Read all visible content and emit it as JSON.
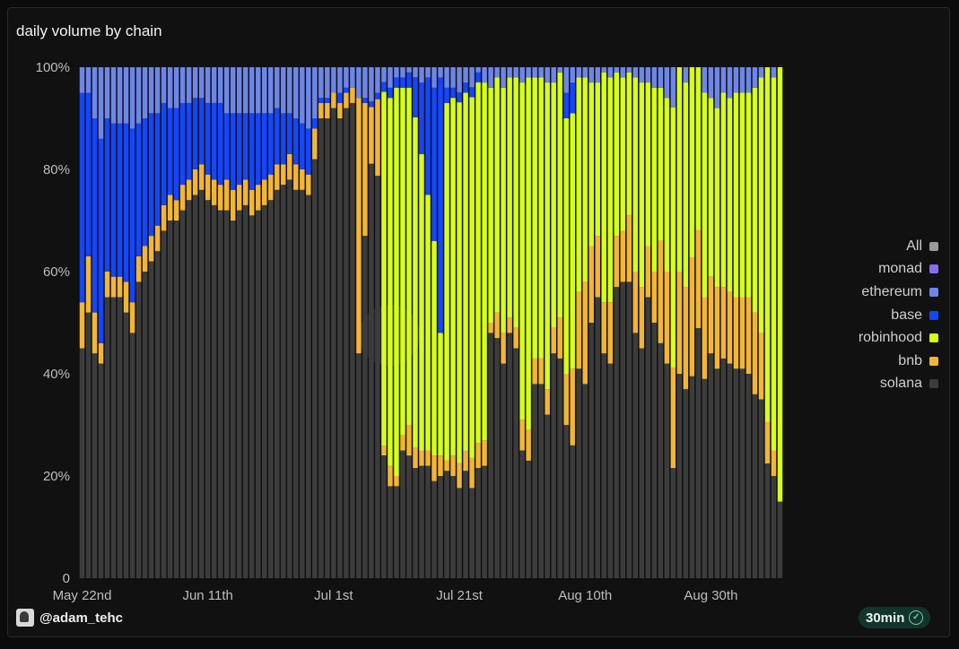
{
  "title": "daily volume by chain",
  "footer": {
    "user": "@adam_tehc",
    "refresh": "30min"
  },
  "legend": [
    {
      "label": "All",
      "color": "#9a9a9a"
    },
    {
      "label": "monad",
      "color": "#8a6cf0"
    },
    {
      "label": "ethereum",
      "color": "#6e86e8"
    },
    {
      "label": "base",
      "color": "#1446ff"
    },
    {
      "label": "robinhood",
      "color": "#d7ff1a"
    },
    {
      "label": "bnb",
      "color": "#f3b535"
    },
    {
      "label": "solana",
      "color": "#3c3c3c"
    }
  ],
  "chart_data": {
    "type": "bar",
    "stacked": true,
    "normalized": true,
    "xlabel": "",
    "ylabel": "",
    "ylim": [
      0,
      100
    ],
    "yticks": [
      "0",
      "20%",
      "40%",
      "60%",
      "80%",
      "100%"
    ],
    "xticks": [
      "May 22nd",
      "Jun 11th",
      "Jul 1st",
      "Jul 21st",
      "Aug 10th",
      "Aug 30th"
    ],
    "date_start": "2025-05-22",
    "series_order": [
      "solana",
      "bnb",
      "robinhood",
      "base",
      "ethereum",
      "monad"
    ],
    "colors": {
      "solana": "#3c3c3c",
      "bnb": "#f3b535",
      "robinhood": "#d7ff1a",
      "base": "#1446ff",
      "ethereum": "#6e86e8",
      "monad": "#8a6cf0"
    },
    "series": [
      {
        "name": "solana",
        "values": [
          45,
          52,
          44,
          42,
          55,
          55,
          55,
          52,
          48,
          58,
          60,
          62,
          64,
          68,
          70,
          70,
          72,
          74,
          75,
          76,
          74,
          73,
          72,
          72,
          70,
          72,
          73,
          71,
          72,
          73,
          74,
          76,
          77,
          78,
          76,
          76,
          75,
          82,
          90,
          90,
          92,
          90,
          92,
          93,
          44,
          67,
          73,
          63,
          25,
          18,
          18,
          25,
          24,
          22,
          22,
          22,
          19,
          20,
          21,
          20,
          18,
          21,
          18,
          22,
          22,
          48,
          47,
          42,
          48,
          45,
          25,
          23,
          38,
          38,
          32,
          44,
          43,
          30,
          26,
          41,
          38,
          50,
          55,
          44,
          42,
          57,
          58,
          58,
          48,
          45,
          55,
          50,
          46,
          42,
          22,
          40,
          37,
          34,
          46,
          39,
          44,
          41,
          43,
          42,
          41,
          41,
          40,
          36,
          35,
          22,
          20,
          15
        ]
      },
      {
        "name": "bnb",
        "values": [
          9,
          11,
          8,
          4,
          5,
          4,
          4,
          6,
          6,
          5,
          5,
          5,
          5,
          5,
          5,
          4,
          5,
          4,
          5,
          5,
          5,
          5,
          5,
          6,
          6,
          5,
          5,
          5,
          5,
          5,
          5,
          5,
          4,
          5,
          5,
          4,
          4,
          6,
          3,
          3,
          3,
          3,
          3,
          3,
          50,
          26,
          10,
          12,
          2,
          4,
          2,
          3,
          6,
          4,
          3,
          3,
          5,
          4,
          2,
          4,
          5,
          4,
          6,
          5,
          5,
          2,
          5,
          6,
          3,
          4,
          6,
          6,
          5,
          5,
          5,
          5,
          8,
          10,
          15,
          15,
          20,
          15,
          12,
          10,
          12,
          10,
          10,
          13,
          12,
          12,
          10,
          10,
          20,
          18,
          20,
          20,
          20,
          20,
          18,
          16,
          15,
          16,
          14,
          14,
          14,
          14,
          15,
          16,
          13,
          8,
          5,
          0
        ]
      },
      {
        "name": "robinhood",
        "values": [
          0,
          0,
          0,
          0,
          0,
          0,
          0,
          0,
          0,
          0,
          0,
          0,
          0,
          0,
          0,
          0,
          0,
          0,
          0,
          0,
          0,
          0,
          0,
          0,
          0,
          0,
          0,
          0,
          0,
          0,
          0,
          0,
          0,
          0,
          0,
          0,
          0,
          0,
          0,
          0,
          0,
          0,
          0,
          0,
          0,
          0,
          0,
          0,
          72,
          72,
          76,
          68,
          66,
          66,
          58,
          50,
          42,
          24,
          70,
          70,
          72,
          70,
          72,
          72,
          70,
          46,
          46,
          48,
          47,
          49,
          66,
          69,
          55,
          55,
          60,
          48,
          48,
          50,
          50,
          42,
          40,
          32,
          30,
          45,
          44,
          32,
          30,
          28,
          38,
          40,
          32,
          36,
          30,
          34,
          52,
          40,
          40,
          32,
          30,
          40,
          35,
          35,
          38,
          38,
          40,
          40,
          40,
          44,
          50,
          68,
          73,
          85
        ]
      },
      {
        "name": "base",
        "values": [
          41,
          32,
          38,
          40,
          30,
          30,
          30,
          31,
          34,
          26,
          25,
          24,
          22,
          20,
          17,
          18,
          16,
          15,
          14,
          13,
          14,
          15,
          16,
          13,
          15,
          14,
          13,
          15,
          14,
          13,
          12,
          11,
          10,
          8,
          9,
          9,
          9,
          2,
          1,
          1,
          0,
          2,
          1,
          0,
          0,
          1,
          1,
          1,
          2,
          2,
          2,
          2,
          3,
          8,
          14,
          23,
          30,
          50,
          3,
          2,
          2,
          2,
          2,
          2,
          0,
          0,
          0,
          0,
          0,
          0,
          0,
          0,
          0,
          0,
          0,
          0,
          0,
          5,
          6,
          0,
          0,
          0,
          0,
          0,
          0,
          0,
          0,
          0,
          0,
          0,
          0,
          0,
          0,
          0,
          0,
          0,
          0,
          0,
          0,
          0,
          0,
          0,
          0,
          0,
          0,
          0,
          0,
          0,
          0,
          0,
          0,
          0
        ]
      },
      {
        "name": "ethereum",
        "values": [
          5,
          5,
          10,
          14,
          10,
          11,
          11,
          11,
          12,
          11,
          10,
          9,
          9,
          7,
          8,
          8,
          7,
          7,
          6,
          6,
          7,
          7,
          7,
          9,
          9,
          9,
          9,
          9,
          9,
          9,
          9,
          8,
          9,
          9,
          10,
          11,
          12,
          10,
          6,
          6,
          5,
          5,
          4,
          4,
          6,
          6,
          6,
          4,
          3,
          4,
          2,
          2,
          1,
          2,
          3,
          2,
          4,
          2,
          4,
          4,
          5,
          3,
          4,
          1,
          3,
          4,
          2,
          4,
          2,
          2,
          3,
          2,
          2,
          2,
          3,
          3,
          1,
          5,
          3,
          2,
          2,
          3,
          3,
          1,
          2,
          1,
          2,
          1,
          2,
          3,
          3,
          4,
          4,
          6,
          8,
          0,
          3,
          0,
          0,
          5,
          6,
          8,
          5,
          6,
          5,
          5,
          5,
          4,
          2,
          0,
          2,
          0
        ]
      },
      {
        "name": "monad",
        "values": [
          0,
          0,
          0,
          0,
          0,
          0,
          0,
          0,
          0,
          0,
          0,
          0,
          0,
          0,
          0,
          0,
          0,
          0,
          0,
          0,
          0,
          0,
          0,
          0,
          0,
          0,
          0,
          0,
          0,
          0,
          0,
          0,
          0,
          0,
          0,
          0,
          0,
          0,
          0,
          0,
          0,
          0,
          0,
          0,
          0,
          0,
          0,
          0,
          0,
          0,
          0,
          0,
          0,
          0,
          0,
          0,
          0,
          0,
          0,
          0,
          0,
          0,
          0,
          0,
          0,
          0,
          0,
          0,
          0,
          0,
          0,
          0,
          0,
          0,
          0,
          0,
          0,
          0,
          0,
          0,
          0,
          0,
          0,
          0,
          0,
          0,
          0,
          0,
          0,
          0,
          0,
          0,
          0,
          0,
          0,
          0,
          0,
          0,
          0,
          0,
          0,
          0,
          0,
          0,
          0,
          0,
          0,
          0,
          0,
          0,
          0,
          0
        ]
      }
    ]
  }
}
